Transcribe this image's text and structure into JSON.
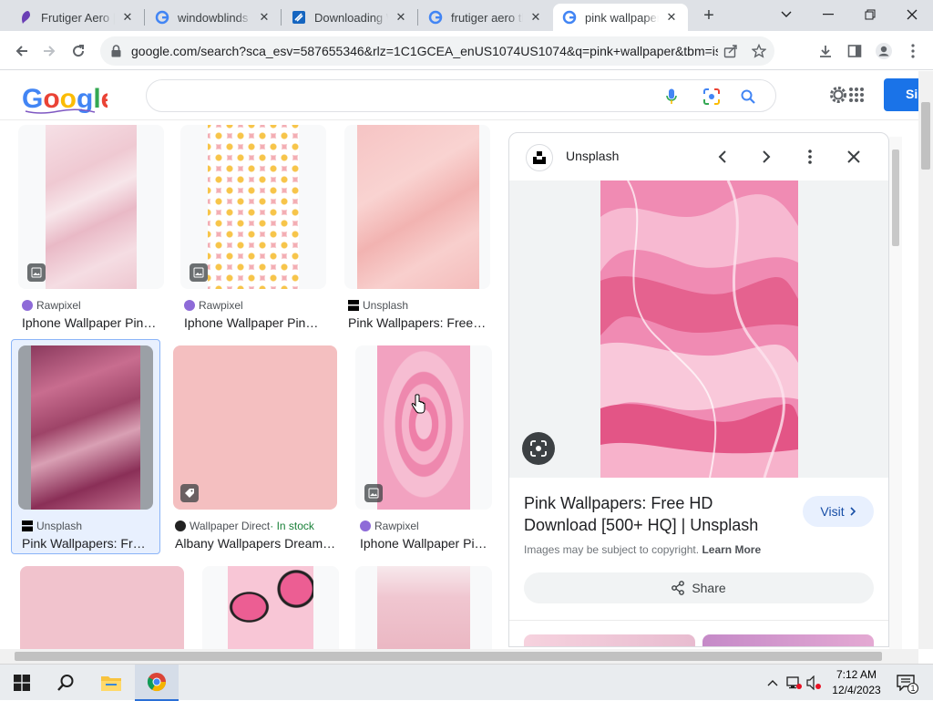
{
  "browser": {
    "tabs": [
      {
        "title": "Frutiger Aero | A",
        "favicon": "purple-app-icon"
      },
      {
        "title": "windowblinds -",
        "favicon": "google-icon"
      },
      {
        "title": "Downloading W",
        "favicon": "stardock-icon"
      },
      {
        "title": "frutiger aero the",
        "favicon": "google-icon"
      },
      {
        "title": "pink wallpaper -",
        "favicon": "google-icon",
        "active": true
      }
    ],
    "new_tab_label": "+",
    "url": "google.com/search?sca_esv=587655346&rlz=1C1GCEA_enUS1074US1074&q=pink+wallpaper&tbm=isch&..."
  },
  "google": {
    "logo": "Google",
    "search_value": "",
    "signin_label": "Si"
  },
  "results": [
    {
      "source": "Rawpixel",
      "caption": "Iphone Wallpaper Pin…",
      "source_icon": "rawpixel-icon",
      "badge": "image-icon"
    },
    {
      "source": "Rawpixel",
      "caption": "Iphone Wallpaper Pin…",
      "source_icon": "rawpixel-icon",
      "badge": "image-icon"
    },
    {
      "source": "Unsplash",
      "caption": "Pink Wallpapers: Free …",
      "source_icon": "unsplash-icon"
    },
    {
      "source": "Unsplash",
      "caption": "Pink Wallpapers: Fre…",
      "source_icon": "unsplash-icon",
      "selected": true
    },
    {
      "source": "Wallpaper Direct",
      "stock": " · In stock",
      "caption": "Albany Wallpapers Dream…",
      "source_icon": "wallpaperdirect-icon",
      "badge": "tag-icon"
    },
    {
      "source": "Rawpixel",
      "caption": "Iphone Wallpaper Pi…",
      "source_icon": "rawpixel-icon",
      "badge": "image-icon"
    }
  ],
  "panel": {
    "source": "Unsplash",
    "title": "Pink Wallpapers: Free HD Download [500+ HQ] | Unsplash",
    "visit_label": "Visit",
    "copyright_text": "Images may be subject to copyright.",
    "learn_more": "Learn More",
    "share_label": "Share"
  },
  "taskbar": {
    "time": "7:12 AM",
    "date": "12/4/2023",
    "notification_count": "1"
  },
  "colors": {
    "accent": "#1a73e8",
    "selected_bg": "#e8f0fe",
    "in_stock": "#188038"
  }
}
